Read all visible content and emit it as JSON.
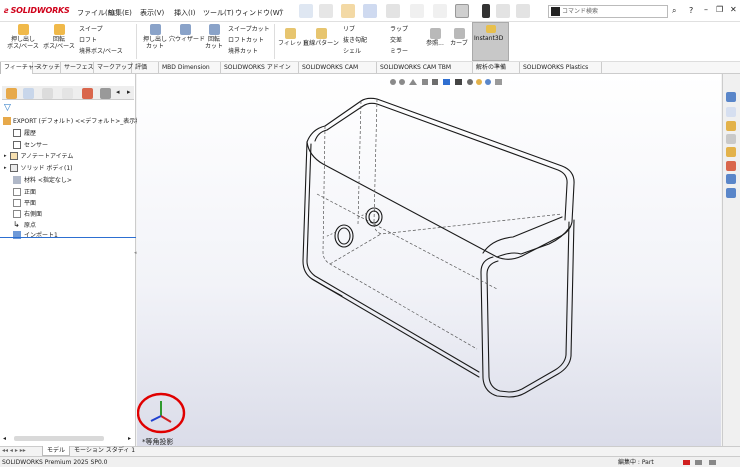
{
  "app": {
    "logo_brand": "SOLIDWORKS",
    "menu": [
      "ファイル(F)",
      "編集(E)",
      "表示(V)",
      "挿入(I)",
      "ツール(T)",
      "ウィンドウ(W)"
    ],
    "search_placeholder": "コマンド検索"
  },
  "ribbon": {
    "extrude_boss": [
      "押し出し",
      "ボス/ベース"
    ],
    "revolve_boss": [
      "回転",
      "ボス/ベース"
    ],
    "sweep": "スイープ",
    "loft": "ロフト",
    "boundary_boss": "境界ボス/ベース",
    "extrude_cut": [
      "押し出し",
      "カット"
    ],
    "hole_wizard": "穴ウィザード",
    "revolve_cut": [
      "回転",
      "カット"
    ],
    "swept_cut": "スイープカット",
    "lofted_cut": "ロフトカット",
    "boundary_cut": "境界カット",
    "fillet": "フィレット",
    "linear_pattern": "直線パターン",
    "rib": "リブ",
    "draft": "抜き勾配",
    "shell": "シェル",
    "wrap": "ラップ",
    "intersect": "交差",
    "mirror": "ミラー",
    "reference": "参照...",
    "curves": "カーブ",
    "instant3d": "Instant3D"
  },
  "tabs": [
    "フィーチャー",
    "スケッチ",
    "サーフェス",
    "マークアップ",
    "評価",
    "MBD Dimension",
    "SOLIDWORKS アドイン",
    "SOLIDWORKS CAM",
    "SOLIDWORKS CAM TBM",
    "解析の準備",
    "SOLIDWORKS Plastics"
  ],
  "tree": {
    "root": "EXPORT (デフォルト) <<デフォルト>_表示状",
    "items": [
      "履歴",
      "センサー",
      "アノテートアイテム",
      "ソリッド ボディ(1)",
      "材料 <指定なし>",
      "正面",
      "平面",
      "右側面",
      "原点",
      "インポート1"
    ]
  },
  "viewport": {
    "view_label": "*等角投影"
  },
  "bottom_tabs": [
    "モデル",
    "モーション スタディ 1"
  ],
  "status": {
    "left": "SOLIDWORKS Premium 2025 SP0.0",
    "edit_label": "編集中 : Part"
  },
  "colors": {
    "brand": "#d0021b",
    "selection_blue": "#2d6fd1",
    "triad_circle": "#e00000"
  }
}
